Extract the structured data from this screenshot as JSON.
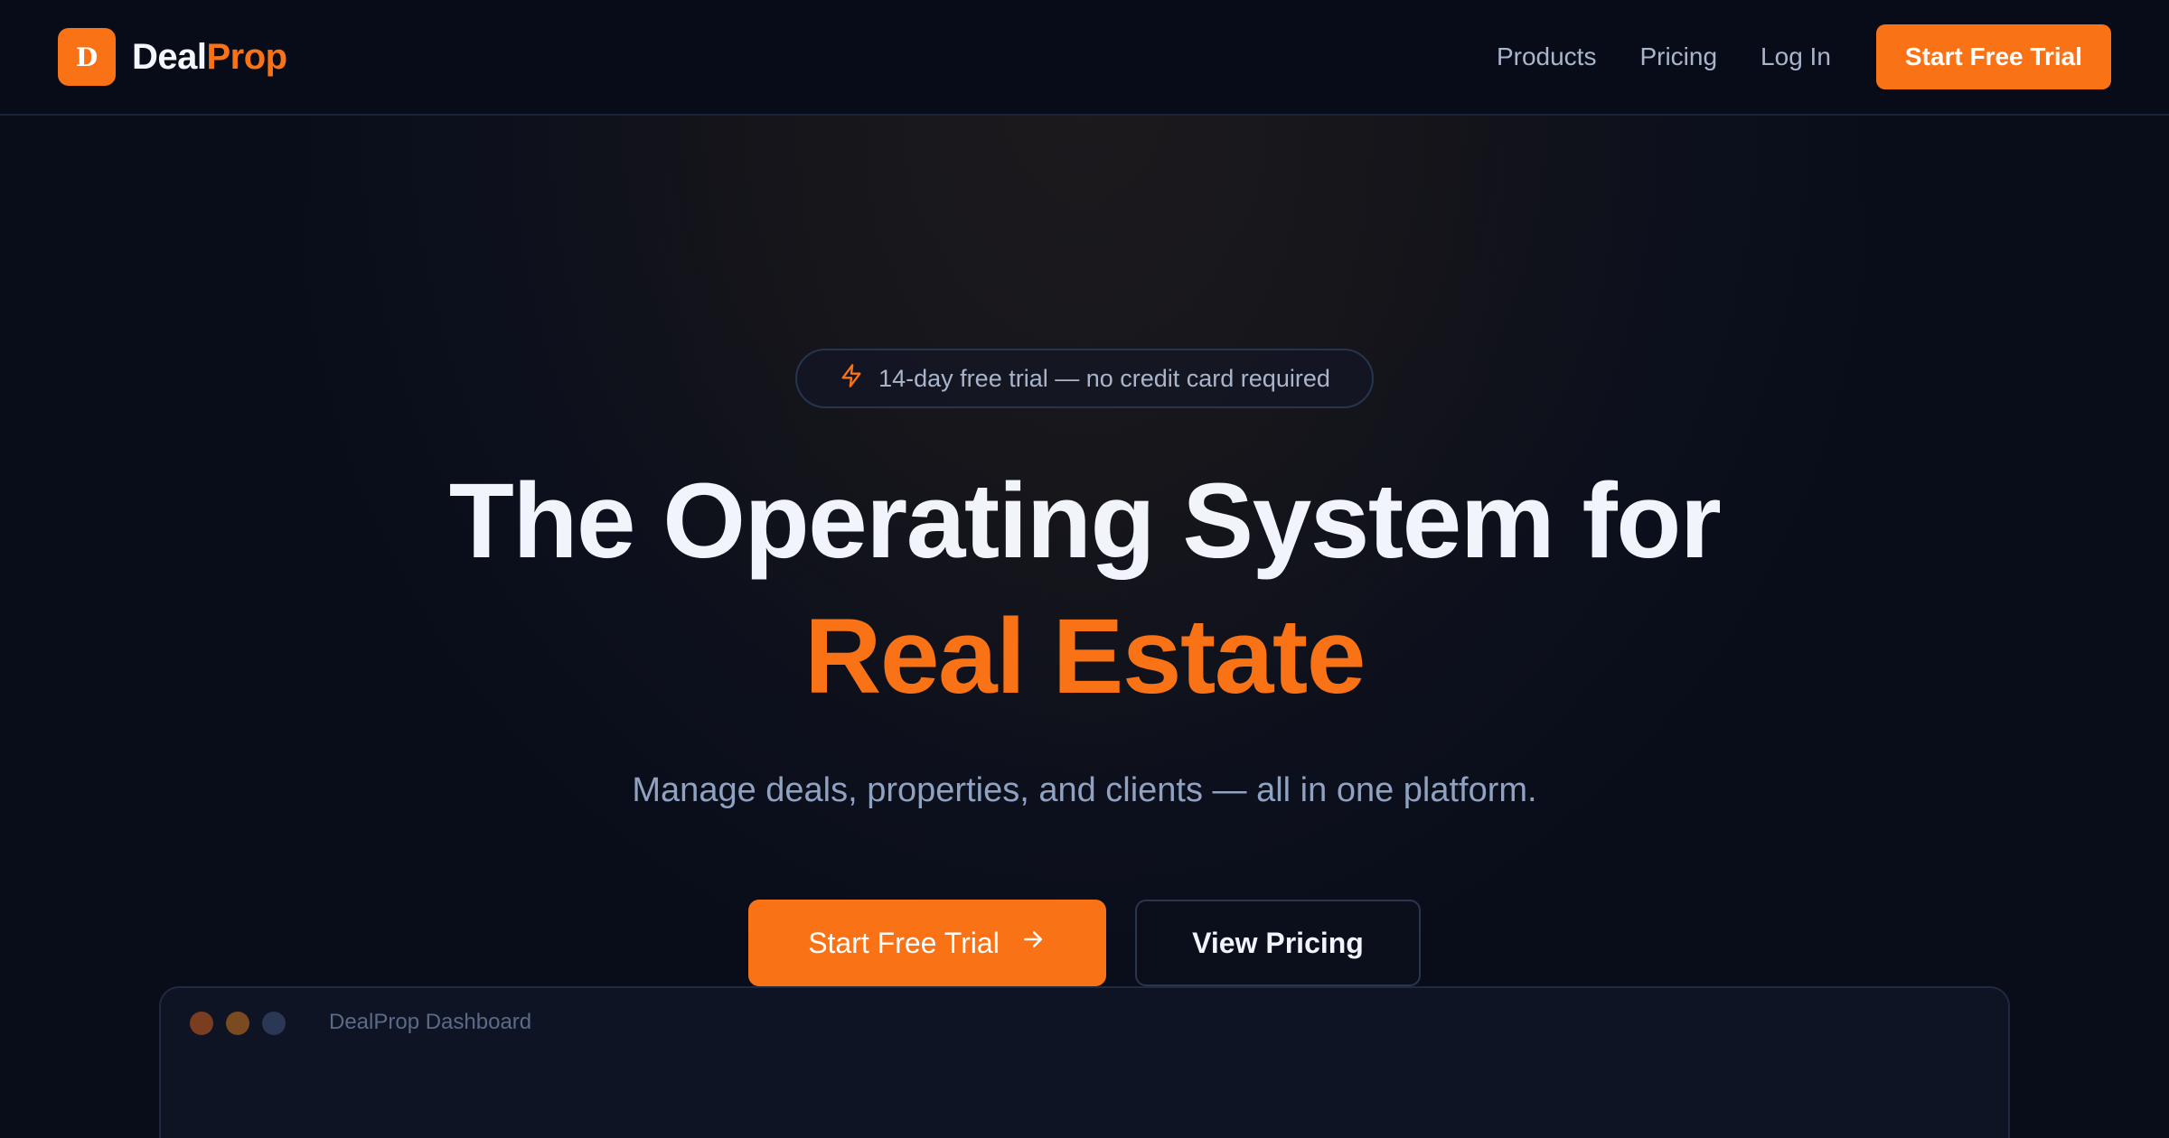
{
  "nav": {
    "logo_letter": "D",
    "brand_part1": "Deal",
    "brand_part2": "Prop",
    "links": [
      "Products",
      "Pricing",
      "Log In"
    ],
    "cta_label": "Start Free Trial"
  },
  "hero": {
    "badge_text": "14-day free trial — no credit card required",
    "headline_line1": "The Operating System for",
    "headline_line2": "Real Estate",
    "subheadline": "Manage deals, properties, and clients — all in one platform.",
    "primary_button": "Start Free Trial",
    "secondary_button": "View Pricing"
  },
  "preview": {
    "window_title": "DealProp Dashboard"
  },
  "colors": {
    "accent": "#f97316",
    "background": "#090d1a",
    "muted_text": "#8fa2c2"
  },
  "icons": {
    "badge_icon": "lightning-bolt-icon",
    "primary_button_icon": "arrow-right-icon"
  }
}
